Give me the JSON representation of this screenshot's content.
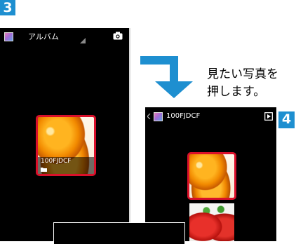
{
  "steps": {
    "first": "3",
    "second": "4"
  },
  "album_screen": {
    "title": "アルバム",
    "app_icon": "gallery-app-icon",
    "camera_icon": "camera-icon",
    "thumbnail": {
      "folder_name": "100FJDCF",
      "folder_icon": "folder-icon",
      "photo": "oranges-photo"
    }
  },
  "folder_screen": {
    "back_icon": "chevron-left-icon",
    "app_icon": "gallery-app-icon",
    "title": "100FJDCF",
    "slideshow_icon": "play-box-icon",
    "photos": [
      "oranges-photo",
      "tomatoes-photo"
    ]
  },
  "instruction": {
    "line1": "見たい写真を",
    "line2": "押します。"
  },
  "colors": {
    "badge": "#1e8fd0",
    "highlight": "#d9102a",
    "arrow": "#1e8fd0"
  }
}
